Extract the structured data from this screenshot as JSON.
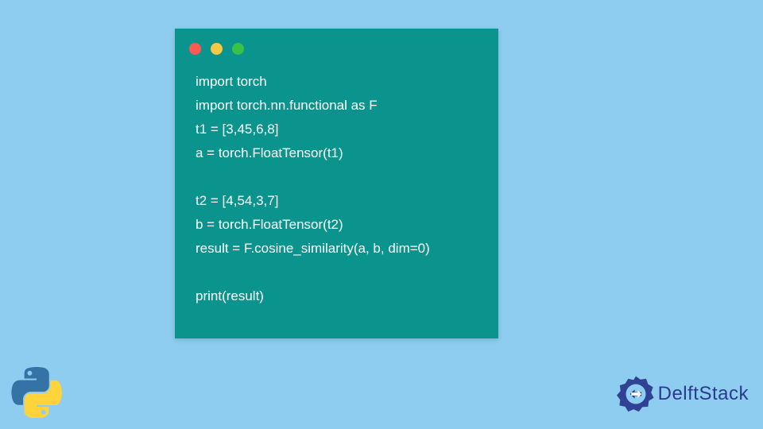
{
  "code": {
    "lines": [
      "import torch",
      "import torch.nn.functional as F",
      "t1 = [3,45,6,8]",
      "a = torch.FloatTensor(t1)",
      "",
      "t2 = [4,54,3,7]",
      "b = torch.FloatTensor(t2)",
      "result = F.cosine_similarity(a, b, dim=0)",
      "",
      "print(result)"
    ]
  },
  "brand": {
    "name": "DelftStack"
  },
  "colors": {
    "background": "#8ecdf0",
    "card": "#0b948d",
    "codeText": "#ffffff",
    "dotRed": "#ff5a52",
    "dotYellow": "#f6c945",
    "dotGreen": "#38c24a",
    "brandText": "#2a3a8e"
  }
}
